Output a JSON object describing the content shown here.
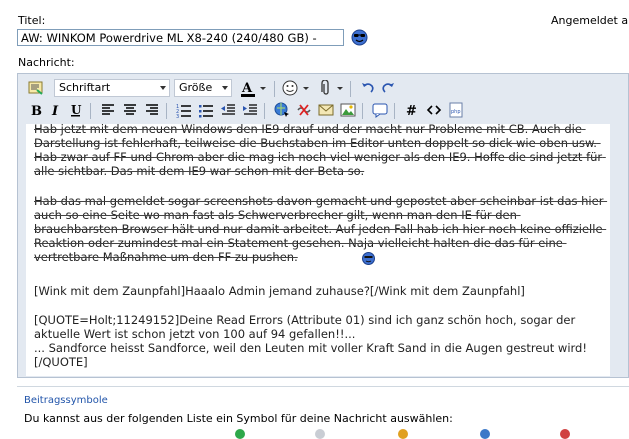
{
  "form": {
    "title_label": "Titel:",
    "logged_in": "Angemeldet a",
    "title_value": "AW: WINKOM Powerdrive ML X8-240 (240/480 GB) -",
    "message_label": "Nachricht:"
  },
  "toolbar": {
    "font_select": "Schriftart",
    "size_select": "Größe"
  },
  "message": {
    "paragraph1": "Hab jetzt mit dem neuen Windows den IE9 drauf und der macht nur Probleme mit CB. Auch die Darstellung ist fehlerhaft, teilweise die Buchstaben im Editor unten doppelt so dick wie oben usw. Hab zwar auf FF und Chrom aber die mag ich noch viel weniger als den IE9. Hoffe die sind jetzt für alle sichtbar. Das mit dem IE9 war schon mit der Beta so.",
    "paragraph2": "Hab das mal gemeldet sogar screenshots davon gemacht und gepostet aber scheinbar ist das hier auch so eine Seite wo man fast als Schwerverbrecher gilt, wenn man den IE für den brauchbarsten Browser hält und nur damit arbeitet. Auf jeden Fall hab ich hier noch keine offizielle Reaktion oder zumindest mal ein Statement gesehen. Naja vielleicht halten die das für eine vertretbare Maßnahme um den FF zu pushen.",
    "paragraph3": "[Wink mit dem Zaunpfahl]Haaalo Admin jemand zuhause?[/Wink mit dem Zaunpfahl]",
    "paragraph4": "[QUOTE=Holt;11249152]Deine Read Errors (Attribute 01) sind ich ganz schön hoch, sogar der aktuelle Wert ist schon jetzt von 100 auf 94 gefallen!!...\n... Sandforce heisst Sandforce, weil den Leuten mit voller Kraft Sand in die Augen gestreut wird![/QUOTE]"
  },
  "post_icons": {
    "legend": "Beitragssymbole",
    "description": "Du kannst aus der folgenden Liste ein Symbol für deine Nachricht auswählen:"
  },
  "colors": {
    "accent_link": "#2255aa",
    "editor_bg": "#e3e9f1",
    "input_border": "#7f9db9"
  }
}
